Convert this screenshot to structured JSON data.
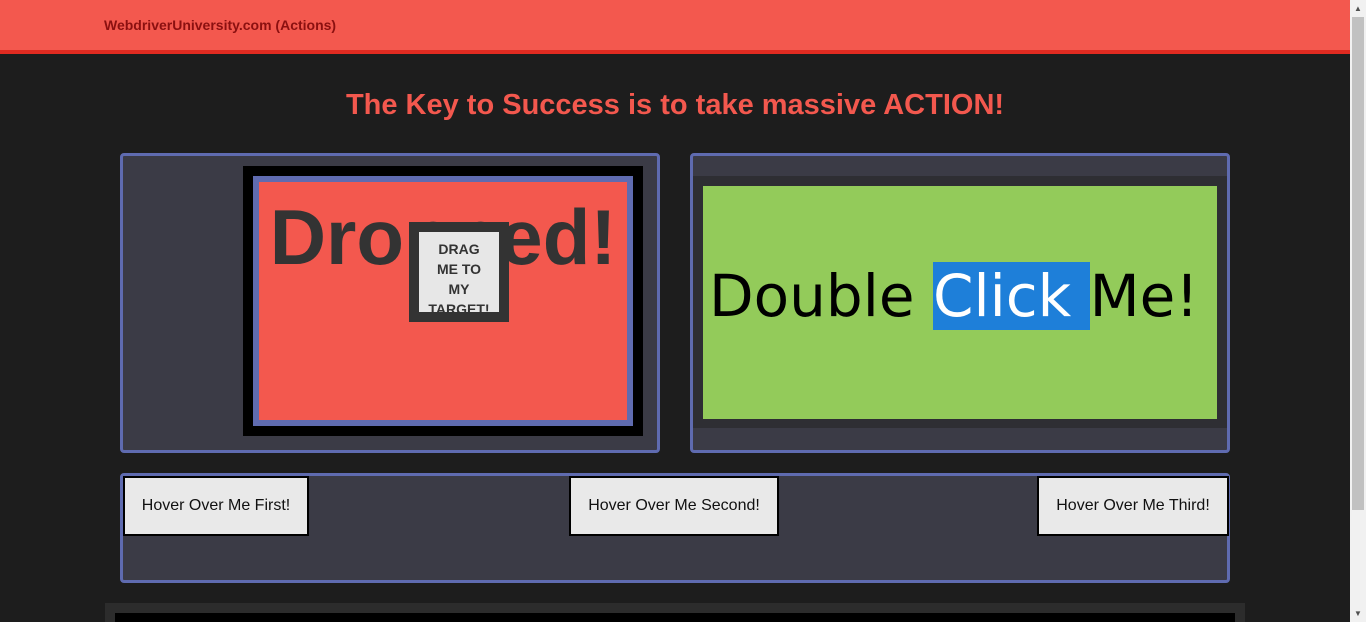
{
  "navbar": {
    "brand": "WebdriverUniversity.com (Actions)"
  },
  "heading": "The Key to Success is to take massive ACTION!",
  "drag_drop": {
    "target_text": "Dropped!",
    "draggable_lines": [
      "DRAG",
      "ME TO",
      "MY",
      "TARGET!"
    ]
  },
  "double_click": {
    "before": "Double ",
    "selected": "Click ",
    "after": "Me!"
  },
  "hover": {
    "first": "Hover Over Me First!",
    "second": "Hover Over Me Second!",
    "third": "Hover Over Me Third!"
  },
  "colors": {
    "navbar": "#f3584e",
    "heading": "#f3584e",
    "panel_border": "#5f6bb0",
    "double_click_box": "#93cb5a",
    "selection": "#1e7fd9"
  },
  "icons": {
    "scroll_up": "▲",
    "scroll_down": "▼"
  }
}
